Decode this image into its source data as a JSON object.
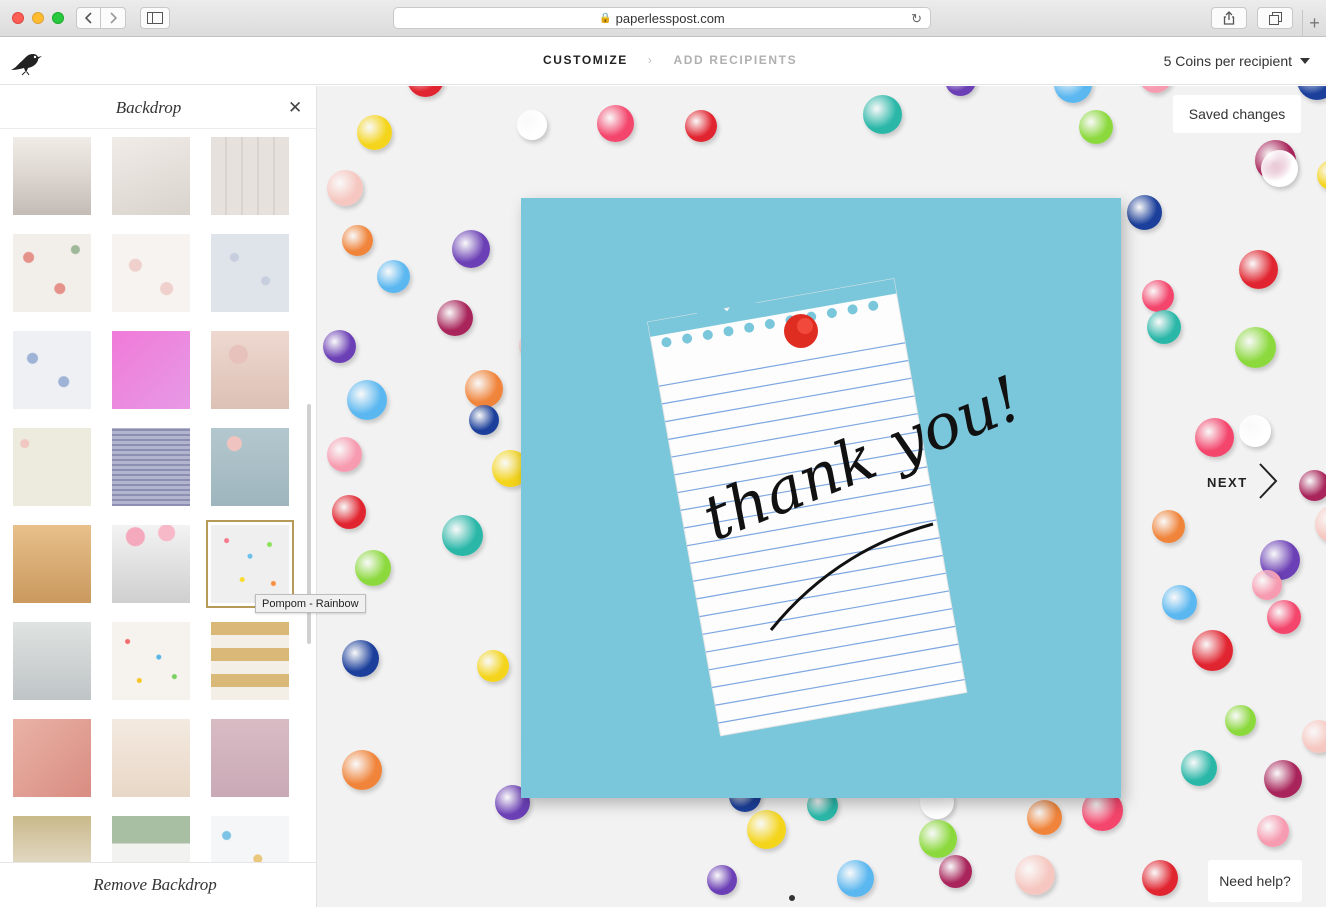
{
  "browser": {
    "url": "paperlesspost.com"
  },
  "header": {
    "steps": [
      {
        "label": "CUSTOMIZE",
        "active": true
      },
      {
        "label": "ADD RECIPIENTS",
        "active": false
      }
    ],
    "coins_label": "5 Coins per recipient"
  },
  "sidebar": {
    "title": "Backdrop",
    "tooltip": "Pompom - Rainbow",
    "remove_label": "Remove Backdrop",
    "thumbnails": [
      "Floral top white",
      "Floral corner",
      "White wood",
      "Rose wallpaper",
      "Soft floral",
      "Blue blossom",
      "Blue floral pattern",
      "Pink cake",
      "Peach flowers",
      "Cream floral",
      "Lavender gingham",
      "Blue roses",
      "Gold gradient",
      "Roses top gradient",
      "Pompom - Rainbow",
      "Fern silver",
      "Sprinkles",
      "Thanks gold",
      "Pink marble",
      "Cream",
      "Pink glitter",
      "Gold glitter",
      "Greenery",
      "Blue confetti"
    ],
    "selected_index": 14
  },
  "card": {
    "message": "thank you!"
  },
  "canvas": {
    "saved_label": "Saved changes",
    "next_label": "NEXT",
    "help_label": "Need help?"
  },
  "colors": {
    "accent_gold": "#b59a5a",
    "card_blue": "#7ac7db"
  }
}
